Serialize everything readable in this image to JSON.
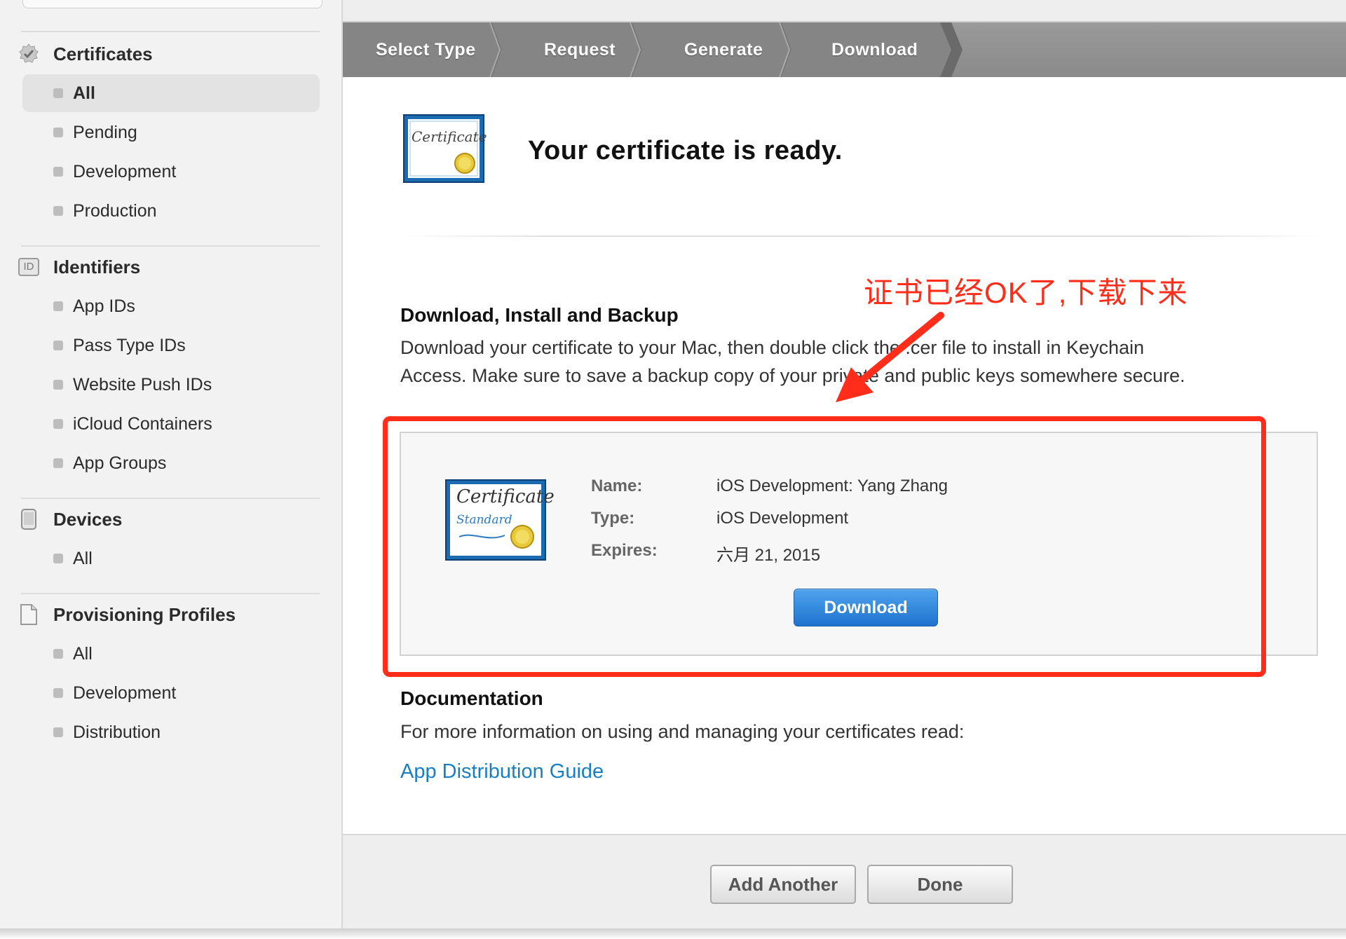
{
  "sidebar": {
    "sections": [
      {
        "title": "Certificates",
        "icon": "certificate-badge-icon",
        "items": [
          {
            "label": "All",
            "active": true
          },
          {
            "label": "Pending"
          },
          {
            "label": "Development"
          },
          {
            "label": "Production"
          }
        ]
      },
      {
        "title": "Identifiers",
        "icon": "id-icon",
        "icon_text": "ID",
        "items": [
          {
            "label": "App IDs"
          },
          {
            "label": "Pass Type IDs"
          },
          {
            "label": "Website Push IDs"
          },
          {
            "label": "iCloud Containers"
          },
          {
            "label": "App Groups"
          }
        ]
      },
      {
        "title": "Devices",
        "icon": "device-icon",
        "items": [
          {
            "label": "All"
          }
        ]
      },
      {
        "title": "Provisioning Profiles",
        "icon": "document-icon",
        "items": [
          {
            "label": "All"
          },
          {
            "label": "Development"
          },
          {
            "label": "Distribution"
          }
        ]
      }
    ]
  },
  "steps": [
    "Select Type",
    "Request",
    "Generate",
    "Download"
  ],
  "header": {
    "title": "Your certificate is ready.",
    "cert_icon_text": "Certificate"
  },
  "install": {
    "heading": "Download, Install and Backup",
    "line1": "Download your certificate to your Mac, then double click the .cer file to install in Keychain",
    "line2": "Access. Make sure to save a backup copy of your private and public keys somewhere secure."
  },
  "certificate": {
    "name_label": "Name:",
    "name_value": "iOS Development: Yang Zhang",
    "type_label": "Type:",
    "type_value": "iOS Development",
    "expires_label": "Expires:",
    "expires_value": "六月 21, 2015",
    "icon_text1": "Certificate",
    "icon_text2": "Standard",
    "download_label": "Download"
  },
  "documentation": {
    "heading": "Documentation",
    "text": "For more information on using and managing your certificates read:",
    "link": "App Distribution Guide"
  },
  "footer": {
    "add_another": "Add Another",
    "done": "Done"
  },
  "annotation": {
    "text": "证书已经OK了,下载下来",
    "color": "#ff2d1a"
  },
  "colors": {
    "accent_blue": "#1f73cf",
    "link": "#1a7fc1",
    "step_bar": "#8f8f8f"
  }
}
